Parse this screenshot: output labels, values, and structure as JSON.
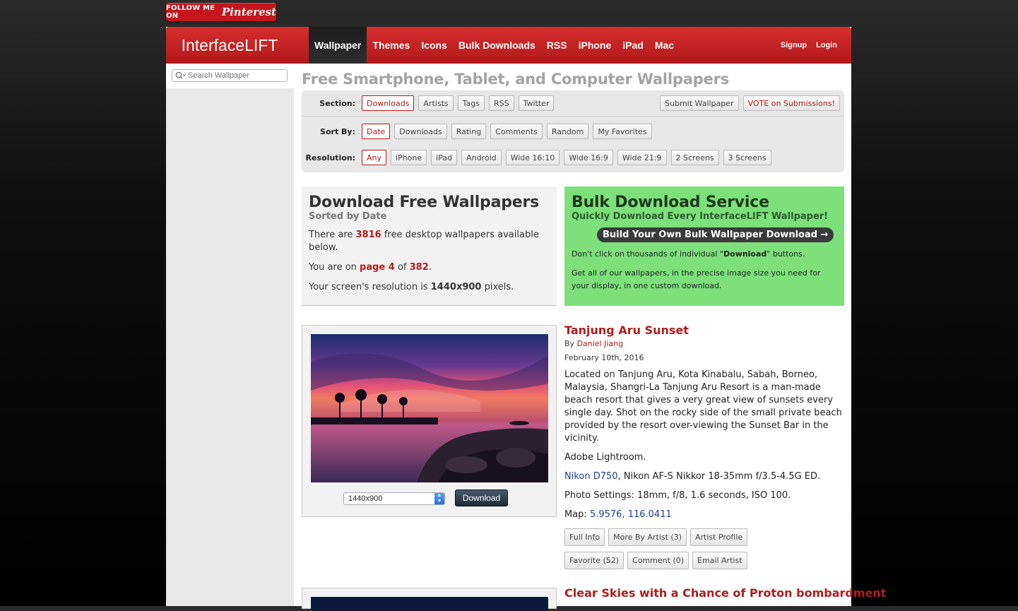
{
  "pinterest": {
    "follow": "FOLLOW ME ON",
    "brand": "Pinterest"
  },
  "header": {
    "logo": "InterfaceLIFT",
    "nav": [
      "Wallpaper",
      "Themes",
      "Icons",
      "Bulk Downloads",
      "RSS",
      "iPhone",
      "iPad",
      "Mac"
    ],
    "active_nav": "Wallpaper",
    "signup": "Signup",
    "login": "Login"
  },
  "search": {
    "placeholder": "Search Wallpaper"
  },
  "page_title": "Free Smartphone, Tablet, and Computer Wallpapers",
  "filters": {
    "section": {
      "label": "Section:",
      "options": [
        "Downloads",
        "Artists",
        "Tags",
        "RSS",
        "Twitter"
      ],
      "selected": "Downloads"
    },
    "submit_wallpaper": "Submit Wallpaper",
    "vote": "VOTE on Submissions!",
    "sort": {
      "label": "Sort By:",
      "options": [
        "Date",
        "Downloads",
        "Rating",
        "Comments",
        "Random",
        "My Favorites"
      ],
      "selected": "Date"
    },
    "resolution": {
      "label": "Resolution:",
      "options": [
        "Any",
        "iPhone",
        "iPad",
        "Android",
        "Wide 16:10",
        "Wide 16:9",
        "Wide 21:9",
        "2 Screens",
        "3 Screens"
      ],
      "selected": "Any"
    }
  },
  "download_info": {
    "title": "Download Free Wallpapers",
    "subtitle": "Sorted by Date",
    "line1_pre": "There are ",
    "count": "3816",
    "line1_post": " free desktop wallpapers available below.",
    "line2_pre": "You are on ",
    "page": "page 4",
    "line2_mid": " of ",
    "total_pages": "382",
    "line2_post": ".",
    "line3_pre": "Your screen's resolution is ",
    "resolution": "1440x900",
    "line3_post": " pixels."
  },
  "bulk": {
    "title": "Bulk Download Service",
    "tagline": "Quickly Download Every InterfaceLIFT Wallpaper!",
    "cta": "Build Your Own Bulk Wallpaper Download →",
    "p1_pre": "Don't click on thousands of individual \"",
    "p1_bold": "Download",
    "p1_post": "\" buttons.",
    "p2": "Get all of our wallpapers, in the precise image size you need for your display, in one custom download."
  },
  "wallpaper": {
    "resolution_select": "1440x900",
    "download": "Download",
    "title": "Tanjung Aru Sunset",
    "by": "By ",
    "artist": "Daniel Jiang",
    "date": "February 10th, 2016",
    "description": "Located on Tanjung Aru, Kota Kinabalu, Sabah, Borneo, Malaysia, Shangri-La Tanjung Aru Resort is a man-made beach resort that gives a very great view of sunsets every single day. Shot on the rocky side of the small private beach provided by the resort over-viewing the Sunset Bar in the vicinity.",
    "software": "Adobe Lightroom.",
    "camera": "Nikon D750",
    "lens": ", Nikon AF-S Nikkor 18-35mm f/3.5-4.5G ED.",
    "settings": "Photo Settings: 18mm, f/8, 1.6 seconds, ISO 100.",
    "map_label": "Map: ",
    "map_coords": "5.9576, 116.0411",
    "buttons_row1": [
      "Full Info",
      "More By Artist (3)",
      "Artist Profile"
    ],
    "buttons_row2": [
      "Favorite (52)",
      "Comment (0)",
      "Email Artist"
    ]
  },
  "next_title": "Clear Skies with a Chance of Proton bombardment"
}
